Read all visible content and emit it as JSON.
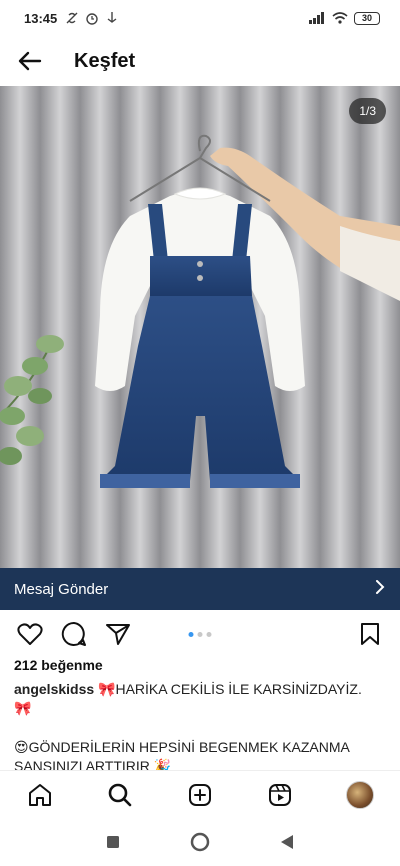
{
  "status_bar": {
    "time": "13:45",
    "battery": "30"
  },
  "header": {
    "title": "Keşfet"
  },
  "post": {
    "image_counter": "1/3",
    "cta_label": "Mesaj Gönder",
    "likes": "212 beğenme",
    "username": "angelskidss",
    "caption_line1": "🎀HARİKA CEKİLİS  İLE KARSİNİZDAYİZ.",
    "caption_line1_end": "🎀",
    "caption_line2": "😍GÖNDERİLERİN HEPSİNİ BEGENMEK KAZANMA SANSINIZI ARTTIRIR 🎉"
  },
  "colors": {
    "cta_bg": "#1d3557",
    "active_dot": "#3897f0"
  },
  "icons": {
    "back": "arrow-left-icon",
    "like": "heart-icon",
    "comment": "comment-icon",
    "share": "send-icon",
    "save": "bookmark-icon",
    "home": "home-icon",
    "search": "search-icon",
    "new_post": "plus-square-icon",
    "reels": "reels-icon"
  }
}
